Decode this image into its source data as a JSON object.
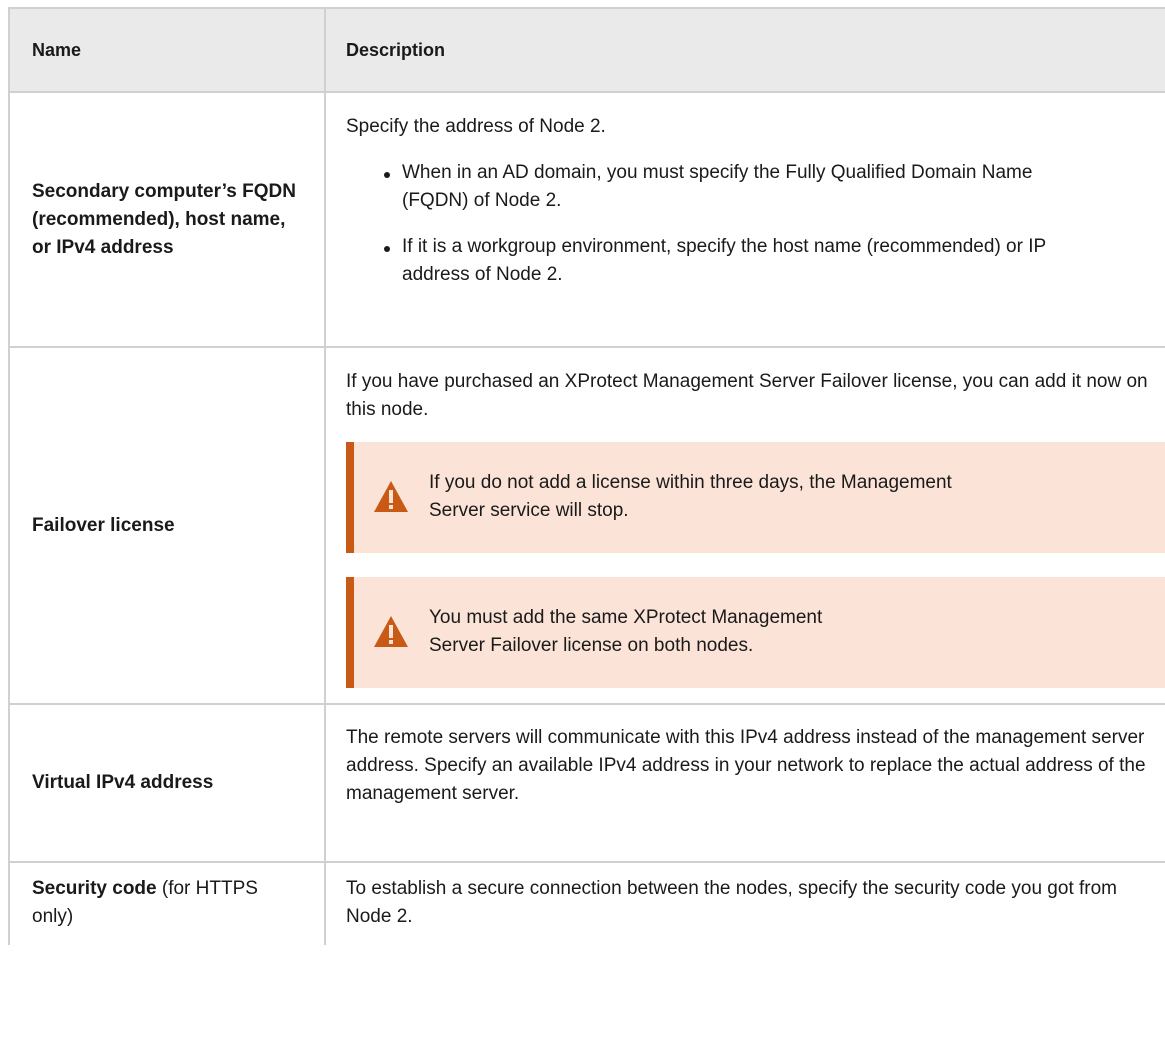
{
  "header": {
    "name": "Name",
    "description": "Description"
  },
  "rows": [
    {
      "name": "Secondary computer’s FQDN (recommended), host name, or IPv4 address",
      "intro": "Specify the address of Node 2.",
      "bullets": [
        "When in an AD domain, you must specify the Fully Qualified Domain Name (FQDN) of Node 2.",
        "If it is a workgroup environment, specify the host name (recommended) or IP address of Node 2."
      ]
    },
    {
      "name": "Failover license",
      "intro": "If you have purchased an XProtect Management Server Failover license, you can add it now on this node.",
      "warnings": [
        {
          "icon": "warning-triangle-icon",
          "text": "If you do not add a license within three days, the Management Server service will stop."
        },
        {
          "icon": "warning-triangle-icon",
          "text": "You must add the same XProtect Management Server Failover license on both nodes."
        }
      ]
    },
    {
      "name": "Virtual IPv4 address",
      "text": "The remote servers will communicate with this IPv4 address instead of the management server address. Specify an available IPv4 address in your network to replace the actual address of the management server."
    },
    {
      "name_bold": "Security code",
      "name_rest": " (for HTTPS only)",
      "text": "To establish a secure connection between the nodes, specify the security code you got from Node 2."
    }
  ],
  "colors": {
    "warning_accent": "#c85a16",
    "warning_bg": "#fbe3d7",
    "header_bg": "#eaeaea",
    "border": "#cdd1d4"
  }
}
